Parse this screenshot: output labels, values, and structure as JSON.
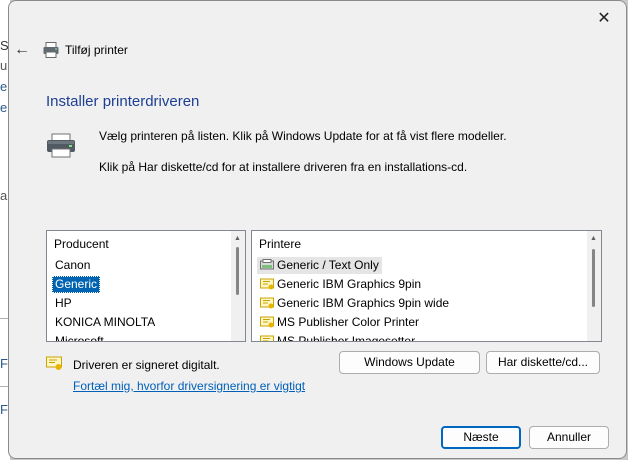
{
  "background": {
    "fragments": [
      "S",
      "u",
      "e",
      "e",
      "a",
      "F",
      "F"
    ]
  },
  "dialog": {
    "title": "Tilføj printer",
    "close_glyph": "✕",
    "back_glyph": "←",
    "heading": "Installer printerdriveren",
    "instruction_1": "Vælg printeren på listen. Klik på Windows Update for at få vist flere modeller.",
    "instruction_2": "Klik på Har diskette/cd for at installere driveren fra en installations-cd."
  },
  "manufacturers": {
    "header": "Producent",
    "items": [
      "Canon",
      "Generic",
      "HP",
      "KONICA MINOLTA",
      "Microsoft"
    ],
    "selected": "Generic"
  },
  "printers": {
    "header": "Printere",
    "items": [
      "Generic / Text Only",
      "Generic IBM Graphics 9pin",
      "Generic IBM Graphics 9pin wide",
      "MS Publisher Color Printer",
      "MS Publisher Imagesetter"
    ],
    "selected": "Generic / Text Only"
  },
  "signing": {
    "status": "Driveren er signeret digitalt.",
    "link": "Fortæl mig, hvorfor driversignering er vigtigt"
  },
  "buttons": {
    "windows_update": "Windows Update",
    "have_disk": "Har diskette/cd...",
    "next": "Næste",
    "cancel": "Annuller"
  },
  "colors": {
    "accent": "#0063b1",
    "heading": "#1c3f94",
    "link": "#0060b8"
  }
}
